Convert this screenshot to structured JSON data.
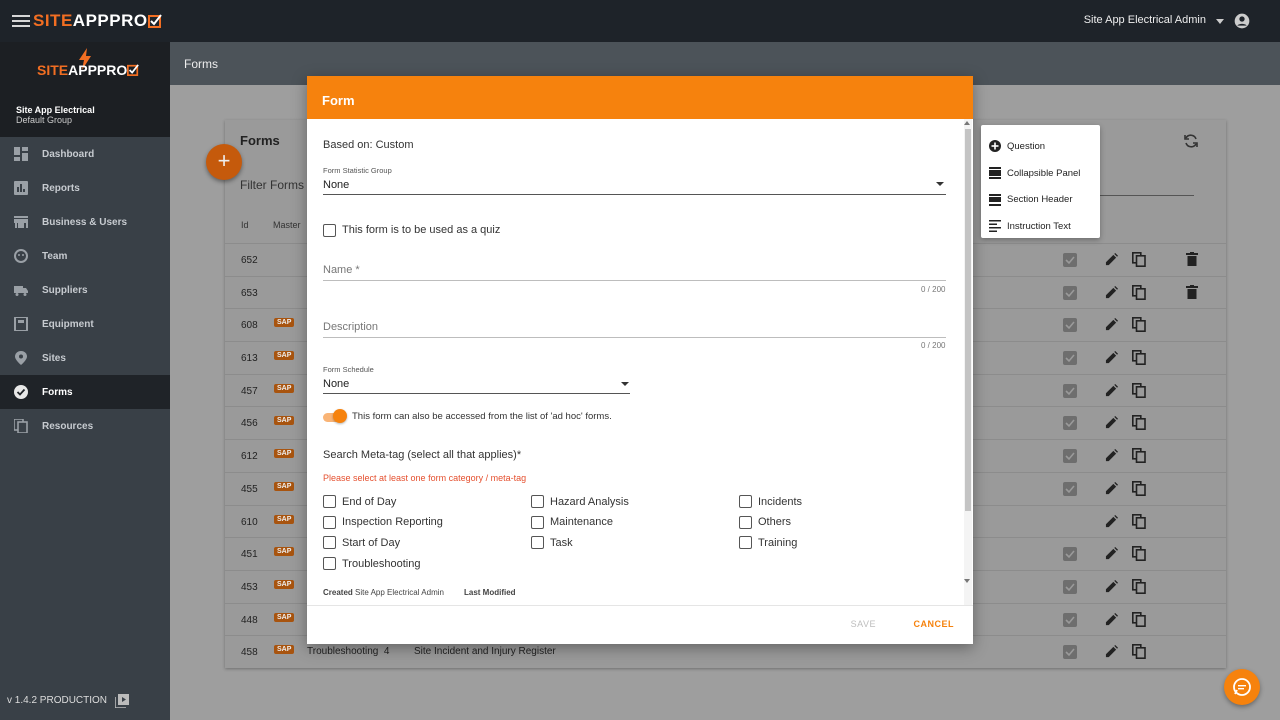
{
  "app": {
    "brand_a": "SITE",
    "brand_b": "APPPRO",
    "user": "Site App Electrical Admin"
  },
  "sidebar": {
    "brand_a": "SITE",
    "brand_b": "APPPRO",
    "org_name": "Site App Electrical",
    "org_group": "Default Group",
    "items": [
      {
        "label": "Dashboard",
        "icon": "dashboard-icon"
      },
      {
        "label": "Reports",
        "icon": "bar-chart-icon"
      },
      {
        "label": "Business & Users",
        "icon": "store-icon"
      },
      {
        "label": "Team",
        "icon": "face-icon"
      },
      {
        "label": "Suppliers",
        "icon": "truck-icon"
      },
      {
        "label": "Equipment",
        "icon": "equipment-icon"
      },
      {
        "label": "Sites",
        "icon": "location-pin-icon"
      },
      {
        "label": "Forms",
        "icon": "check-circle-icon"
      },
      {
        "label": "Resources",
        "icon": "copy-icon"
      }
    ],
    "version": "v 1.4.2 PRODUCTION"
  },
  "page": {
    "breadcrumb": "Forms",
    "card_title": "Forms",
    "filter_placeholder": "Filter Forms",
    "col_id": "Id",
    "col_master": "Master",
    "add_label": "+",
    "rows": [
      {
        "id": "652",
        "sap": false,
        "checked": true,
        "delete": true
      },
      {
        "id": "653",
        "sap": false,
        "checked": true,
        "delete": true
      },
      {
        "id": "608",
        "sap": true,
        "checked": true,
        "delete": false
      },
      {
        "id": "613",
        "sap": true,
        "checked": true,
        "delete": false
      },
      {
        "id": "457",
        "sap": true,
        "checked": true,
        "delete": false
      },
      {
        "id": "456",
        "sap": true,
        "checked": true,
        "delete": false
      },
      {
        "id": "612",
        "sap": true,
        "checked": true,
        "delete": false
      },
      {
        "id": "455",
        "sap": true,
        "checked": true,
        "delete": false
      },
      {
        "id": "610",
        "sap": true,
        "checked": false,
        "delete": false
      },
      {
        "id": "451",
        "sap": true,
        "checked": true,
        "delete": false
      },
      {
        "id": "453",
        "sap": true,
        "checked": true,
        "delete": false
      },
      {
        "id": "448",
        "sap": true,
        "checked": true,
        "delete": false
      },
      {
        "id": "458",
        "sap": true,
        "checked": true,
        "delete": false,
        "c1": "Troubleshooting",
        "c2": "4",
        "c3": "Site Incident and Injury Register"
      }
    ],
    "sap_label": "SAP"
  },
  "dialog": {
    "title": "Form",
    "based_on": "Based on: Custom",
    "stat_group_label": "Form Statistic Group",
    "stat_group_value": "None",
    "quiz_label": "This form is to be used as a quiz",
    "name_label": "Name *",
    "name_count": "0 / 200",
    "desc_label": "Description",
    "desc_count": "0 / 200",
    "schedule_label": "Form Schedule",
    "schedule_value": "None",
    "adhoc_label": "This form can also be accessed from the list of 'ad hoc' forms.",
    "adhoc_on": true,
    "meta_heading": "Search Meta-tag (select all that applies)*",
    "meta_error": "Please select at least one form category / meta-tag",
    "meta_tags": [
      [
        "End of Day",
        "Hazard Analysis",
        "Incidents"
      ],
      [
        "Inspection Reporting",
        "Maintenance",
        "Others"
      ],
      [
        "Start of Day",
        "Task",
        "Training"
      ],
      [
        "Troubleshooting"
      ]
    ],
    "created_label": "Created",
    "created_value": "Site App Electrical Admin",
    "modified_label": "Last Modified",
    "save": "SAVE",
    "cancel": "CANCEL"
  },
  "add_menu": {
    "items": [
      {
        "label": "Question",
        "icon": "add-circle-icon"
      },
      {
        "label": "Collapsible Panel",
        "icon": "panel-icon"
      },
      {
        "label": "Section Header",
        "icon": "section-header-icon"
      },
      {
        "label": "Instruction Text",
        "icon": "text-lines-icon"
      }
    ]
  },
  "colors": {
    "accent": "#f6820d",
    "topbar": "#1e2329",
    "sidebar": "#394047"
  }
}
